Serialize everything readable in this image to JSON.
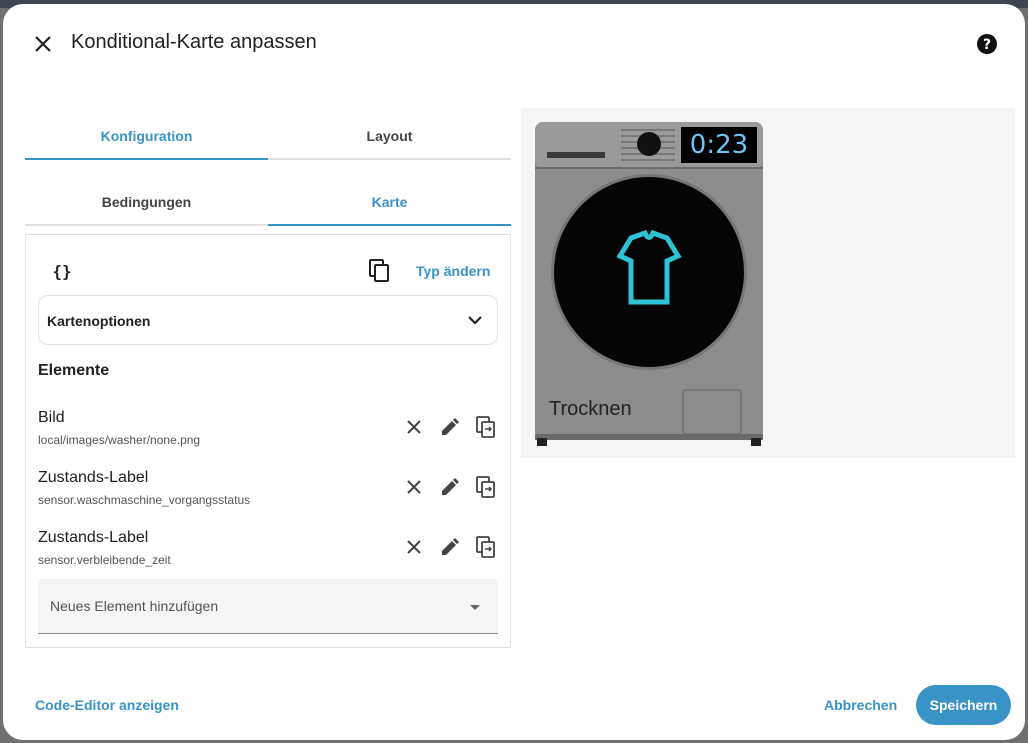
{
  "dialog": {
    "title": "Konditional-Karte anpassen"
  },
  "tabs_main": [
    {
      "label": "Konfiguration",
      "active": true
    },
    {
      "label": "Layout",
      "active": false
    }
  ],
  "tabs_sub": [
    {
      "label": "Bedingungen",
      "active": false
    },
    {
      "label": "Karte",
      "active": true
    }
  ],
  "editor": {
    "code_icon": "{}",
    "change_type_label": "Typ ändern",
    "card_options_label": "Kartenoptionen",
    "elements_heading": "Elemente",
    "elements": [
      {
        "title": "Bild",
        "subtitle": "local/images/washer/none.png"
      },
      {
        "title": "Zustands-Label",
        "subtitle": "sensor.waschmaschine_vorgangsstatus"
      },
      {
        "title": "Zustands-Label",
        "subtitle": "sensor.verbleibende_zeit"
      }
    ],
    "add_element_placeholder": "Neues Element hinzufügen"
  },
  "preview": {
    "time": "0:23",
    "state": "Trocknen"
  },
  "footer": {
    "code_editor_label": "Code-Editor anzeigen",
    "cancel_label": "Abbrechen",
    "save_label": "Speichern"
  },
  "colors": {
    "accent": "#3a93c6",
    "shirt_icon": "#2ec4d6"
  }
}
